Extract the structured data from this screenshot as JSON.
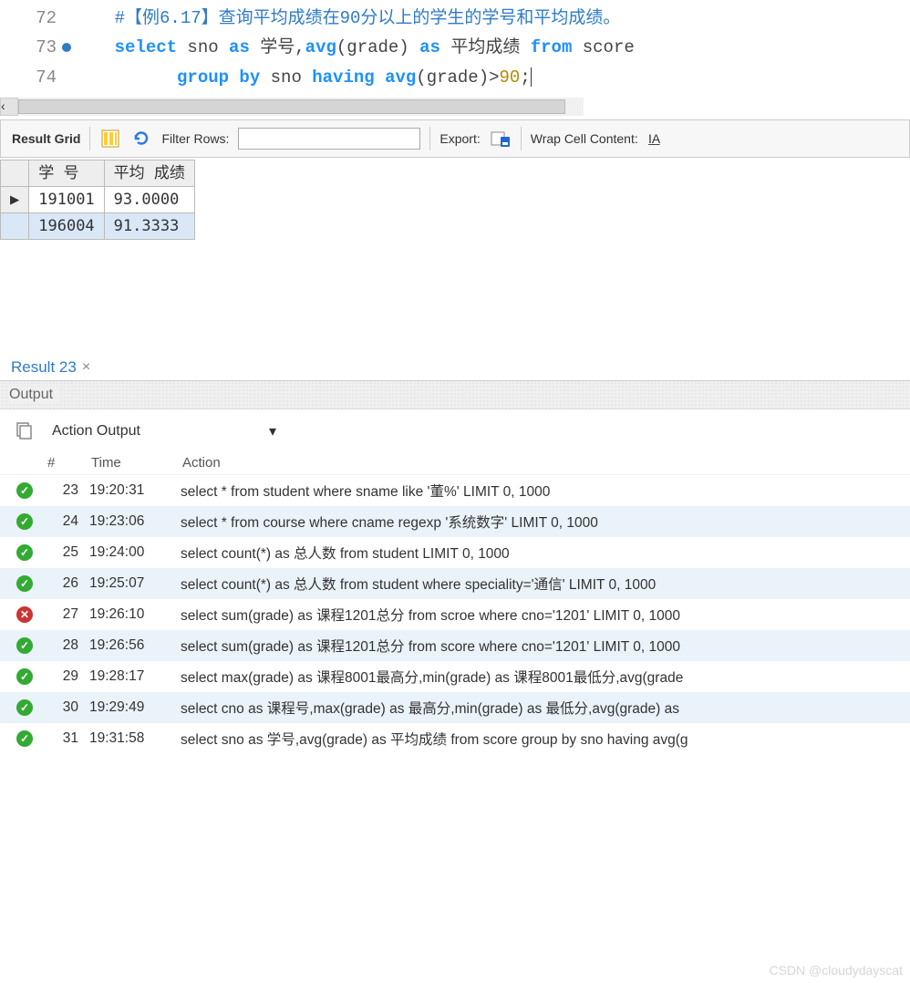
{
  "editor": {
    "lines": [
      {
        "num": "72",
        "bp": false,
        "tokens": [
          {
            "t": "indent"
          },
          {
            "t": "comment",
            "v": "#【例6.17】查询平均成绩在90分以上的学生的学号和平均成绩。"
          }
        ]
      },
      {
        "num": "73",
        "bp": true,
        "tokens": [
          {
            "t": "indent"
          },
          {
            "t": "kw",
            "v": "select"
          },
          {
            "t": "plain",
            "v": " sno "
          },
          {
            "t": "kw",
            "v": "as"
          },
          {
            "t": "plain",
            "v": " 学号,"
          },
          {
            "t": "kw",
            "v": "avg"
          },
          {
            "t": "plain",
            "v": "(grade) "
          },
          {
            "t": "kw",
            "v": "as"
          },
          {
            "t": "plain",
            "v": " 平均成绩 "
          },
          {
            "t": "kw",
            "v": "from"
          },
          {
            "t": "plain",
            "v": " score"
          }
        ]
      },
      {
        "num": "74",
        "bp": false,
        "tokens": [
          {
            "t": "indent"
          },
          {
            "t": "indent2"
          },
          {
            "t": "kw",
            "v": "group by"
          },
          {
            "t": "plain",
            "v": " sno "
          },
          {
            "t": "kw",
            "v": "having"
          },
          {
            "t": "plain",
            "v": " "
          },
          {
            "t": "kw",
            "v": "avg"
          },
          {
            "t": "plain",
            "v": "(grade)>"
          },
          {
            "t": "num",
            "v": "90"
          },
          {
            "t": "plain",
            "v": ";"
          },
          {
            "t": "cursor"
          }
        ]
      }
    ]
  },
  "result_toolbar": {
    "grid_label": "Result Grid",
    "filter_label": "Filter Rows:",
    "filter_placeholder": "",
    "export_label": "Export:",
    "wrap_label": "Wrap Cell Content:"
  },
  "grid": {
    "columns": [
      "学\n号",
      "平均\n成绩"
    ],
    "rows": [
      {
        "cells": [
          "191001",
          "93.0000"
        ],
        "current": true
      },
      {
        "cells": [
          "196004",
          "91.3333"
        ],
        "current": false,
        "selected": true
      }
    ]
  },
  "tabs": {
    "active": "Result 23"
  },
  "output": {
    "panel_label": "Output",
    "selector": "Action Output",
    "columns": {
      "num": "#",
      "time": "Time",
      "action": "Action"
    },
    "rows": [
      {
        "status": "ok",
        "num": "23",
        "time": "19:20:31",
        "action": "select * from student where sname like '董%' LIMIT 0, 1000"
      },
      {
        "status": "ok",
        "num": "24",
        "time": "19:23:06",
        "action": "select * from course where cname regexp '系统数字' LIMIT 0, 1000"
      },
      {
        "status": "ok",
        "num": "25",
        "time": "19:24:00",
        "action": "select count(*) as 总人数 from student LIMIT 0, 1000"
      },
      {
        "status": "ok",
        "num": "26",
        "time": "19:25:07",
        "action": "select count(*) as 总人数 from student  where speciality='通信' LIMIT 0, 1000"
      },
      {
        "status": "err",
        "num": "27",
        "time": "19:26:10",
        "action": "select sum(grade) as 课程1201总分 from scroe where cno='1201' LIMIT 0, 1000"
      },
      {
        "status": "ok",
        "num": "28",
        "time": "19:26:56",
        "action": "select sum(grade) as 课程1201总分 from score where cno='1201' LIMIT 0, 1000"
      },
      {
        "status": "ok",
        "num": "29",
        "time": "19:28:17",
        "action": "select max(grade) as 课程8001最高分,min(grade) as 课程8001最低分,avg(grade"
      },
      {
        "status": "ok",
        "num": "30",
        "time": "19:29:49",
        "action": "select cno as 课程号,max(grade) as 最高分,min(grade) as 最低分,avg(grade) as "
      },
      {
        "status": "ok",
        "num": "31",
        "time": "19:31:58",
        "action": "select sno as 学号,avg(grade) as 平均成绩 from score group by sno having avg(g"
      }
    ]
  },
  "watermark": "CSDN @cloudydayscat"
}
